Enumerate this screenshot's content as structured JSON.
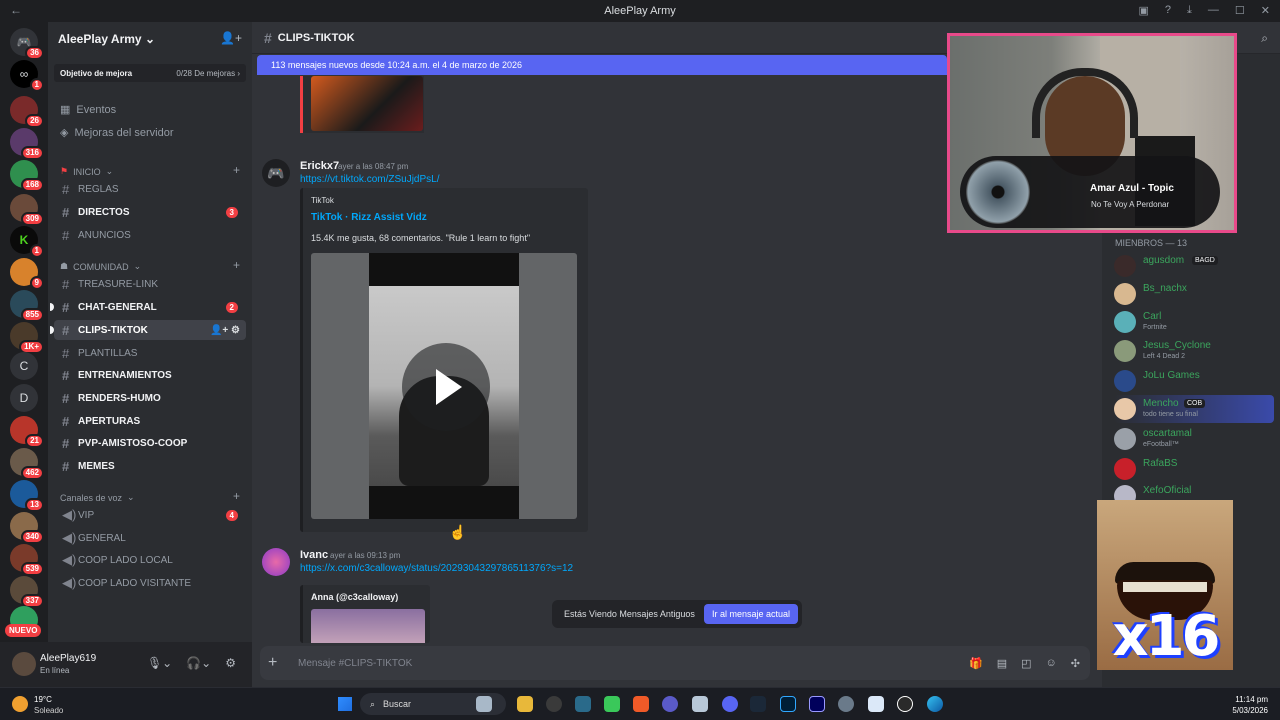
{
  "window": {
    "title": "AleePlay Army",
    "back": "←"
  },
  "server": {
    "name": "AleePlay Army",
    "boost_label": "Objetivo de mejora",
    "boost_progress": "0/28 De mejoras",
    "links": [
      {
        "label": "Eventos",
        "icon": "calendar-icon"
      },
      {
        "label": "Mejoras del servidor",
        "icon": "boost-icon"
      }
    ],
    "categories": {
      "inicio": "INICIO",
      "comunidad": "COMUNIDAD",
      "voz": "Canales de voz"
    },
    "channels": [
      {
        "name": "REGLAS"
      },
      {
        "name": "DIRECTOS",
        "badge": "3"
      },
      {
        "name": "ANUNCIOS"
      },
      {
        "name": "TREASURE-LINK"
      },
      {
        "name": "CHAT-GENERAL",
        "badge": "2"
      },
      {
        "name": "CLIPS-TIKTOK"
      },
      {
        "name": "PLANTILLAS"
      },
      {
        "name": "ENTRENAMIENTOS"
      },
      {
        "name": "RENDERS-HUMO"
      },
      {
        "name": "APERTURAS"
      },
      {
        "name": "PVP-AMISTOSO-COOP"
      },
      {
        "name": "MEMES"
      }
    ],
    "voice_channels": [
      {
        "name": "VIP",
        "badge": "4"
      },
      {
        "name": "GENERAL"
      },
      {
        "name": "COOP LADO LOCAL"
      },
      {
        "name": "COOP LADO VISITANTE"
      }
    ]
  },
  "guilds": {
    "badges": [
      "36",
      "1",
      "26",
      "316",
      "168",
      "309",
      "1",
      "9",
      "855",
      "1K+",
      "21",
      "462",
      "13",
      "340",
      "539",
      "337"
    ],
    "letters": [
      "C",
      "D"
    ],
    "nuevo": "NUEVO"
  },
  "user": {
    "name": "AleePlay619",
    "status": "En línea"
  },
  "channel": {
    "name": "CLIPS-TIKTOK",
    "new_banner": "113 mensajes nuevos desde 10:24 a.m. el 4 de marzo de 2026",
    "composer_placeholder": "Mensaje #CLIPS-TIKTOK"
  },
  "messages": [
    {
      "author": "Erickx7",
      "timestamp": "ayer a las 08:47 pm",
      "link": "https://vt.tiktok.com/ZSuJjdPsL/",
      "embed": {
        "provider": "TikTok",
        "title": "TikTok · Rizz Assist Vidz",
        "description": "15.4K me gusta, 68 comentarios. \"Rule 1 learn to fight\""
      }
    },
    {
      "author": "Ivanc",
      "timestamp": "ayer a las 09:13 pm",
      "link": "https://x.com/c3calloway/status/2029304329786511376?s=12",
      "embed": {
        "author": "Anna (@c3calloway)"
      }
    }
  ],
  "jump": {
    "text": "Estás Viendo Mensajes Antiguos",
    "button": "Ir al mensaje actual"
  },
  "now_playing": {
    "title": "Amar Azul - Topic",
    "subtitle": "No Te Voy A Perdonar"
  },
  "members": {
    "header": "MIENBROS — 13",
    "list": [
      {
        "name": "agusdom",
        "tag": "BAGD",
        "color": "#3ba55d"
      },
      {
        "name": "Bs_nachx",
        "color": "#3ba55d"
      },
      {
        "name": "Carl",
        "activity": "Fortnite",
        "color": "#3ba55d"
      },
      {
        "name": "Jesus_Cyclone",
        "activity": "Left 4 Dead 2",
        "color": "#3ba55d"
      },
      {
        "name": "JoLu Games",
        "color": "#3ba55d"
      },
      {
        "name": "Mencho",
        "tag": "COB",
        "activity": "todo tiene su final",
        "color": "#3ba55d"
      },
      {
        "name": "oscartamal",
        "activity": "eFootball™",
        "color": "#3ba55d"
      },
      {
        "name": "RafaBS",
        "color": "#3ba55d"
      },
      {
        "name": "XefoOficial",
        "color": "#3ba55d"
      }
    ]
  },
  "overlay": {
    "meme_text": "x16"
  },
  "taskbar": {
    "temp": "19°C",
    "condition": "Soleado",
    "search": "Buscar",
    "time": "11:14 pm",
    "date": "5/03/2026"
  },
  "colors": {
    "accent": "#5865f2",
    "danger": "#f23f43",
    "link": "#00a8fc",
    "online": "#3ba55d"
  }
}
